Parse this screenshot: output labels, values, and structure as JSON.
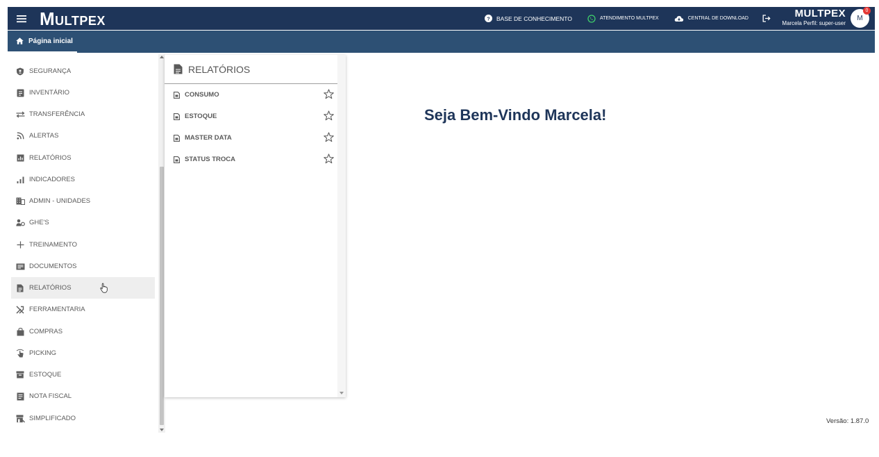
{
  "header": {
    "brand_logo": "MULTPEX",
    "links": [
      {
        "label": "BASE DE CONHECIMENTO",
        "icon": "help-circle-icon"
      },
      {
        "label": "ATENDIMENTO MULTPEX",
        "icon": "whatsapp-icon"
      },
      {
        "label": "CENTRAL DE DOWNLOAD",
        "icon": "cloud-download-icon"
      }
    ],
    "user": {
      "brand": "MULTPEX",
      "info": "Marcela  Perfil: super-user",
      "avatar_initial": "M",
      "notifications": "0"
    }
  },
  "breadcrumb": {
    "label": "Página inicial",
    "icon": "home-icon"
  },
  "sidebar": {
    "items": [
      {
        "label": "SEGURANÇA",
        "icon": "shield-icon"
      },
      {
        "label": "INVENTÁRIO",
        "icon": "clipboard-icon"
      },
      {
        "label": "TRANSFERÊNCIA",
        "icon": "swap-icon"
      },
      {
        "label": "ALERTAS",
        "icon": "rss-icon"
      },
      {
        "label": "RELATÓRIOS",
        "icon": "report-chart-icon"
      },
      {
        "label": "INDICADORES",
        "icon": "bar-chart-icon"
      },
      {
        "label": "ADMIN - UNIDADES",
        "icon": "building-icon"
      },
      {
        "label": "GHE'S",
        "icon": "group-icon"
      },
      {
        "label": "TREINAMENTO",
        "icon": "plus-icon"
      },
      {
        "label": "DOCUMENTOS",
        "icon": "document-card-icon"
      },
      {
        "label": "RELATÓRIOS",
        "icon": "file-text-icon",
        "active": true
      },
      {
        "label": "FERRAMENTARIA",
        "icon": "tools-icon"
      },
      {
        "label": "COMPRAS",
        "icon": "shopping-bag-icon"
      },
      {
        "label": "PICKING",
        "icon": "hand-pointer-icon"
      },
      {
        "label": "ESTOQUE",
        "icon": "archive-icon"
      },
      {
        "label": "NOTA FISCAL",
        "icon": "receipt-icon"
      },
      {
        "label": "SIMPLIFICADO",
        "icon": "store-icon"
      }
    ]
  },
  "flyout": {
    "title": "RELATÓRIOS",
    "items": [
      {
        "label": "CONSUMO"
      },
      {
        "label": "ESTOQUE"
      },
      {
        "label": "MASTER DATA"
      },
      {
        "label": "STATUS TROCA"
      }
    ]
  },
  "main": {
    "welcome": "Seja Bem-Vindo Marcela!",
    "version": "Versão: 1.87.0"
  },
  "colors": {
    "header": "#1e3559",
    "breadcrumb_bar": "#2d5074",
    "active_item": "#eeeeee",
    "welcome_text": "#1e3559"
  }
}
